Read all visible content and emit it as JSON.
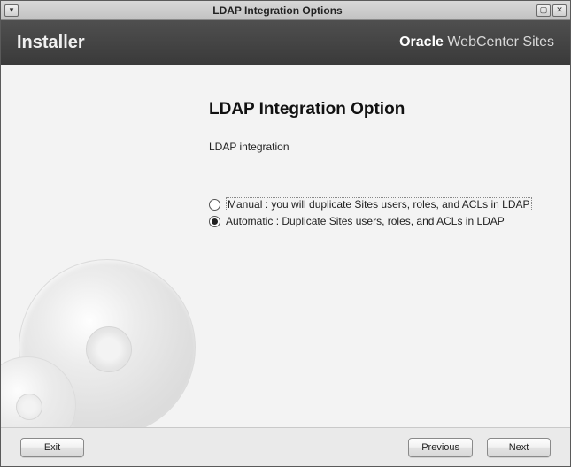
{
  "window": {
    "title": "LDAP Integration Options"
  },
  "header": {
    "left": "Installer",
    "brand_strong": "Oracle",
    "brand_light": " WebCenter Sites"
  },
  "main": {
    "title": "LDAP Integration Option",
    "subtitle": "LDAP integration",
    "options": [
      {
        "label": "Manual : you will duplicate Sites users, roles, and ACLs in LDAP",
        "selected": false
      },
      {
        "label": "Automatic : Duplicate Sites users, roles, and ACLs in LDAP",
        "selected": true
      }
    ]
  },
  "footer": {
    "exit": "Exit",
    "previous": "Previous",
    "next": "Next"
  },
  "icons": {
    "menu": "▾",
    "maximize": "▢",
    "close": "✕"
  }
}
